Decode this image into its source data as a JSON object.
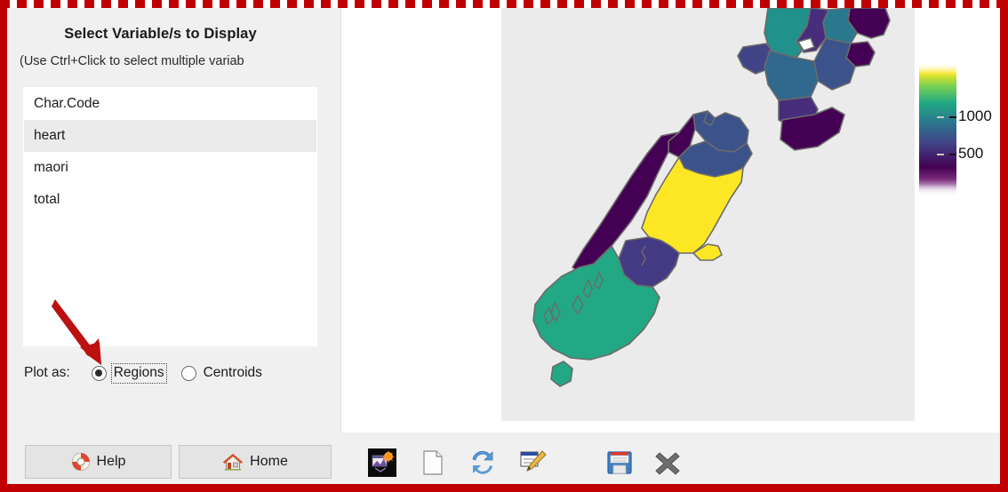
{
  "window": {
    "accent_border_color": "#c00000",
    "background": "#f0f0f0"
  },
  "left_panel": {
    "title": "Select Variable/s to Display",
    "subtitle": "(Use Ctrl+Click to select multiple variab",
    "variables": [
      {
        "label": "Char.Code",
        "striped": false
      },
      {
        "label": "heart",
        "striped": true
      },
      {
        "label": "maori",
        "striped": false
      },
      {
        "label": "total",
        "striped": false
      }
    ],
    "plot_as": {
      "label": "Plot as:",
      "options": [
        {
          "label": "Regions",
          "selected": true,
          "focused": true
        },
        {
          "label": "Centroids",
          "selected": false,
          "focused": false
        }
      ]
    },
    "annotation_arrow": {
      "name": "red-arrow-annotation",
      "color": "#c00000",
      "points_at": "Regions"
    }
  },
  "plot_panel": {
    "map": {
      "title": "New Zealand regions choropleth",
      "background": "#ebebeb",
      "outline_color": "#6b6b6b"
    },
    "legend": {
      "type": "colorbar",
      "colormap": "viridis",
      "ticks": [
        {
          "label": "1000",
          "position_pct": 60
        },
        {
          "label": "500",
          "position_pct": 32
        }
      ]
    }
  },
  "chart_data": {
    "type": "heatmap",
    "title": "New Zealand regions choropleth",
    "subtype": "choropleth-map",
    "colormap": "viridis",
    "legend_ticks": [
      500,
      1000
    ],
    "value_range": [
      0,
      1300
    ],
    "xlabel": "",
    "ylabel": "",
    "grid": false,
    "legend_position": "right",
    "regions": [
      {
        "name": "Southland",
        "color": "#22a884",
        "value_approx": 900
      },
      {
        "name": "Otago",
        "color": "#fde725",
        "value_approx": 1300
      },
      {
        "name": "Queenstown-Lakes",
        "color": "#443983",
        "value_approx": 300
      },
      {
        "name": "West Coast",
        "color": "#440154",
        "value_approx": 60
      },
      {
        "name": "Canterbury",
        "color": "#3b528b",
        "value_approx": 420
      },
      {
        "name": "Tasman",
        "color": "#440154",
        "value_approx": 60
      },
      {
        "name": "Marlborough",
        "color": "#3b528b",
        "value_approx": 420
      },
      {
        "name": "Wellington",
        "color": "#440154",
        "value_approx": 80
      },
      {
        "name": "Manawatu-Wanganui",
        "color": "#31688e",
        "value_approx": 470
      },
      {
        "name": "Hawkes Bay",
        "color": "#3b528b",
        "value_approx": 420
      },
      {
        "name": "Taranaki",
        "color": "#414487",
        "value_approx": 330
      },
      {
        "name": "Waikato",
        "color": "#21918c",
        "value_approx": 700
      },
      {
        "name": "Bay of Plenty",
        "color": "#472d7b",
        "value_approx": 250
      },
      {
        "name": "Gisborne",
        "color": "#440154",
        "value_approx": 70
      },
      {
        "name": "Auckland",
        "color": "#2a788e",
        "value_approx": 520
      },
      {
        "name": "Northland",
        "color": "#440154",
        "value_approx": 90
      },
      {
        "name": "Stewart Island",
        "color": "#22a884",
        "value_approx": 900
      }
    ]
  },
  "bottom_bar": {
    "help_button": {
      "label": "Help",
      "icon": "lifebuoy-icon"
    },
    "home_button": {
      "label": "Home",
      "icon": "house-icon"
    },
    "tools": [
      {
        "name": "plot-thumbnail-icon",
        "tooltip": "Plot"
      },
      {
        "name": "new-document-icon",
        "tooltip": "New"
      },
      {
        "name": "refresh-icon",
        "tooltip": "Refresh"
      },
      {
        "name": "edit-pencil-icon",
        "tooltip": "Edit"
      },
      {
        "name": "save-floppy-icon",
        "tooltip": "Save"
      },
      {
        "name": "close-x-icon",
        "tooltip": "Close"
      }
    ]
  }
}
